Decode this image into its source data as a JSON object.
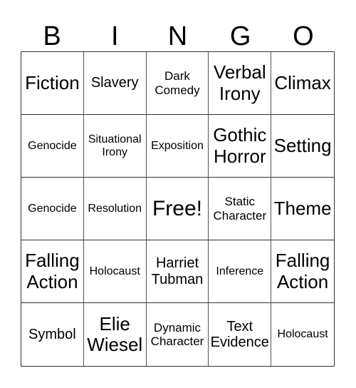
{
  "header": [
    "B",
    "I",
    "N",
    "G",
    "O"
  ],
  "cells": [
    "Fiction",
    "Slavery",
    "Dark Comedy",
    "Verbal Irony",
    "Climax",
    "Genocide",
    "Situational Irony",
    "Exposition",
    "Gothic Horror",
    "Setting",
    "Genocide",
    "Resolution",
    "Free!",
    "Static Character",
    "Theme",
    "Falling Action",
    "Holocaust",
    "Harriet Tubman",
    "Inference",
    "Falling Action",
    "Symbol",
    "Elie Wiesel",
    "Dynamic Character",
    "Text Evidence",
    "Holocaust"
  ]
}
